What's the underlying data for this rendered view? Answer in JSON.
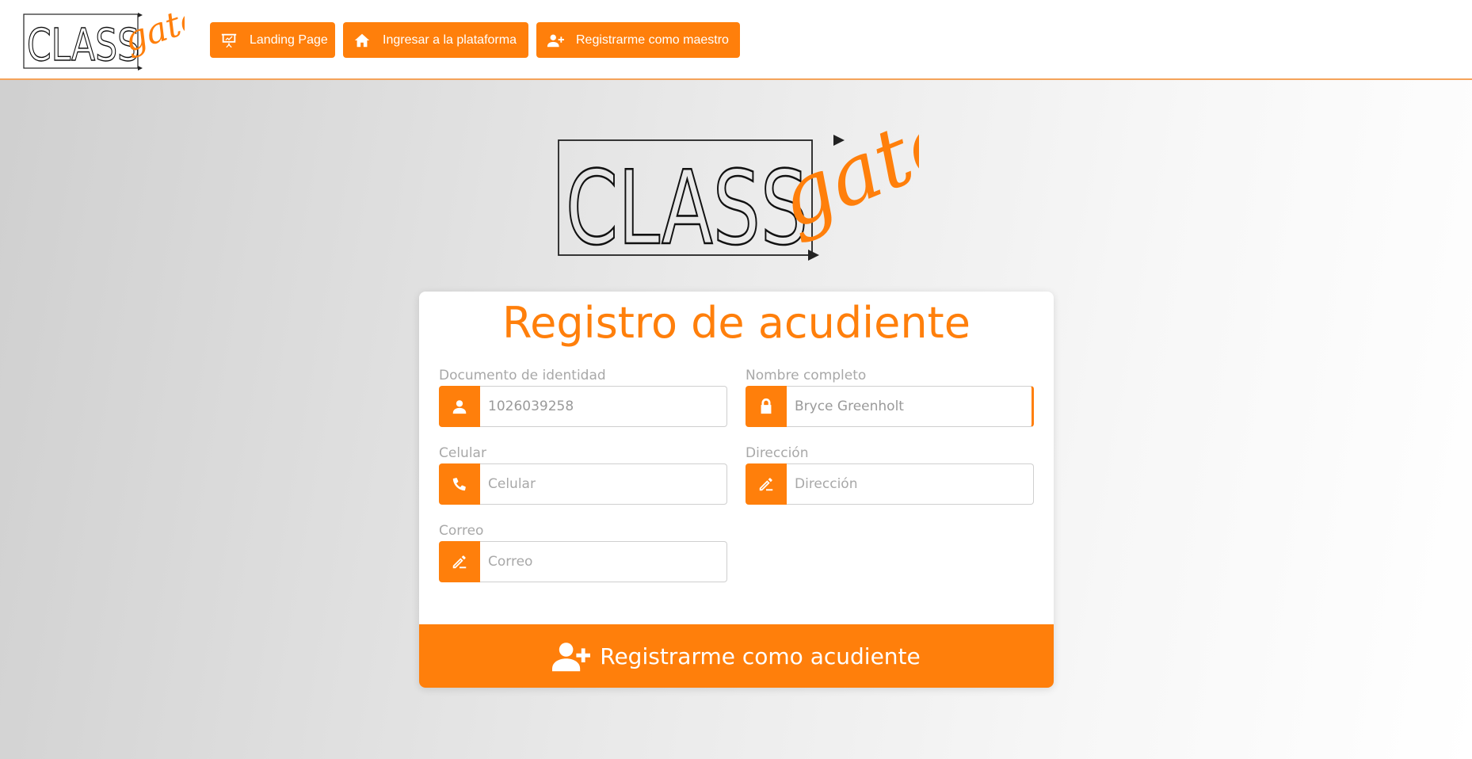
{
  "brand": {
    "logo_text": "CLASS",
    "logo_script": "gate",
    "accent": "#ff7f0b"
  },
  "nav": [
    {
      "label": "Landing Page",
      "icon": "presentation-icon"
    },
    {
      "label": "Ingresar a la plataforma",
      "icon": "home-icon"
    },
    {
      "label": "Registrarme como maestro",
      "icon": "user-plus-icon"
    }
  ],
  "form": {
    "title": "Registro de acudiente",
    "fields": {
      "documento": {
        "label": "Documento de identidad",
        "value": "1026039258",
        "placeholder": "Documento de identidad",
        "icon": "user-icon"
      },
      "nombre": {
        "label": "Nombre completo",
        "value": "Bryce Greenholt",
        "placeholder": "Nombre completo",
        "icon": "lock-icon"
      },
      "celular": {
        "label": "Celular",
        "value": "",
        "placeholder": "Celular",
        "icon": "phone-icon"
      },
      "direccion": {
        "label": "Dirección",
        "value": "",
        "placeholder": "Dirección",
        "icon": "pen-icon"
      },
      "correo": {
        "label": "Correo",
        "value": "",
        "placeholder": "Correo",
        "icon": "pen-icon"
      }
    },
    "submit_label": "Registrarme como acudiente"
  }
}
